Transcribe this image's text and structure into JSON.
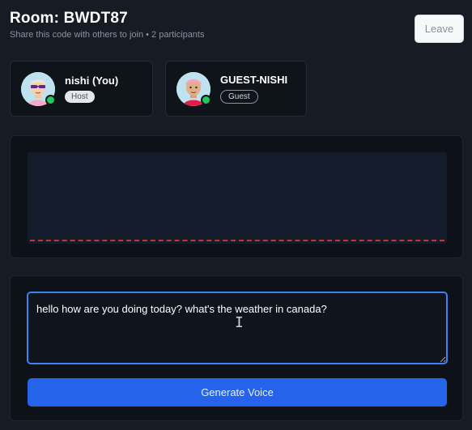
{
  "room": {
    "title": "Room: BWDT87",
    "subtitle": "Share this code with others to join • 2 participants"
  },
  "leave_button": {
    "label": "Leave"
  },
  "participants": [
    {
      "name": "nishi (You)",
      "role": "Host",
      "avatar": "avatar-sunglasses-icon",
      "online": true
    },
    {
      "name": "GUEST-NISHI",
      "role": "Guest",
      "avatar": "avatar-pink-hair-icon",
      "online": true
    }
  ],
  "text_input": {
    "value": "hello how are you doing today? what's the weather in canada?"
  },
  "generate_button": {
    "label": "Generate Voice"
  },
  "colors": {
    "accent": "#2563eb",
    "focus_border": "#3b82f6",
    "online": "#22c55e",
    "waveform_line": "#c0392b"
  }
}
